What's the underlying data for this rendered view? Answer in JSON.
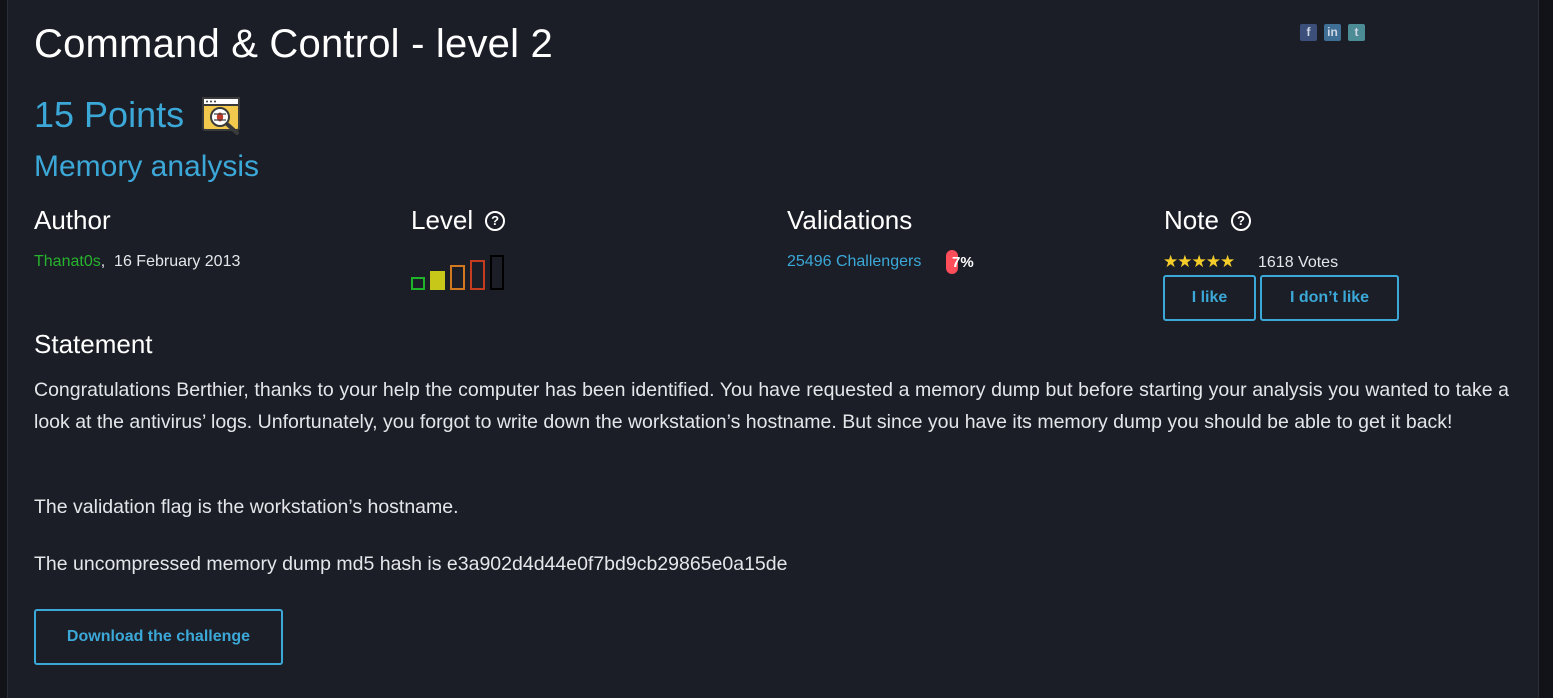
{
  "challenge": {
    "title": "Command & Control - level 2",
    "points": "15 Points",
    "category": "Memory analysis"
  },
  "share": {
    "facebook": "f",
    "linkedin": "in",
    "twitter": "t"
  },
  "author": {
    "heading": "Author",
    "name": "Thanat0s",
    "date": ",  16 February 2013"
  },
  "level": {
    "heading": "Level",
    "help": "?",
    "difficulty": 2,
    "max": 5
  },
  "validations": {
    "heading": "Validations",
    "challengers": "25496 Challengers",
    "percent": "7%"
  },
  "note": {
    "heading": "Note",
    "help": "?",
    "stars": "★★★★★",
    "votes": "1618 Votes",
    "like": "I like",
    "dislike": "I don’t like"
  },
  "statement": {
    "heading": "Statement",
    "p1": "Congratulations Berthier, thanks to your help the computer has been identified. You have requested a memory dump but before starting your analysis you wanted to take a look at the antivirus’ logs. Unfortunately, you forgot to write down the workstation’s hostname. But since you have its memory dump you should be able to get it back!",
    "p2": "The validation flag is the workstation’s hostname.",
    "p3": "The uncompressed memory dump md5 hash is e3a902d4d44e0f7bd9cb29865e0a15de"
  },
  "download": {
    "label": "Download the challenge"
  },
  "colors": {
    "accent": "#3ca8d8",
    "author": "#27b32e",
    "percent_bar": "#ff4d5a",
    "stars": "#f5cd2a",
    "level_colors": [
      "#1fb32a",
      "#c7c71a",
      "#d2781e",
      "#c63c1e",
      "#000000"
    ]
  }
}
